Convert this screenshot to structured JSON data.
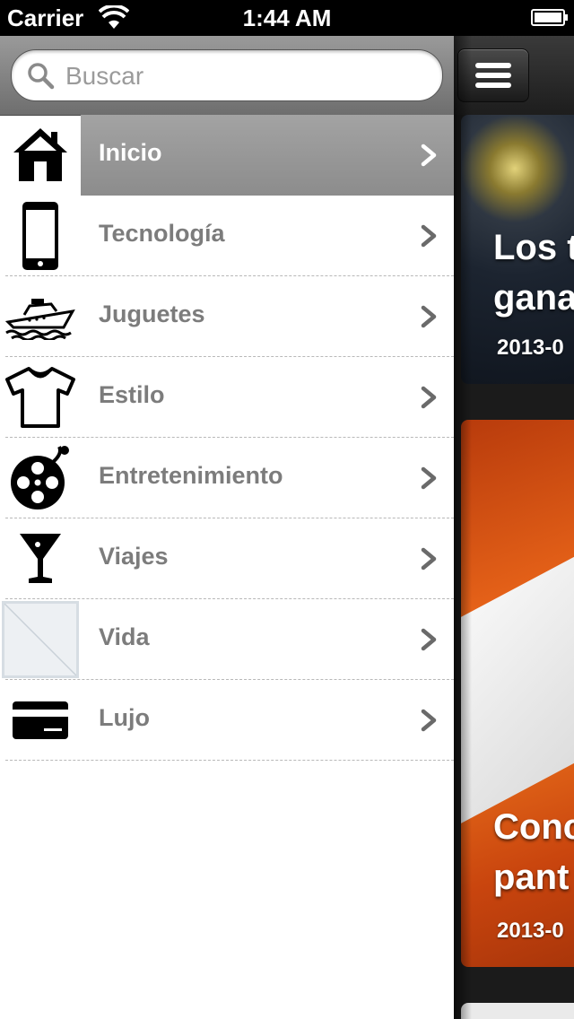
{
  "status_bar": {
    "carrier": "Carrier",
    "time": "1:44 AM"
  },
  "search": {
    "placeholder": "Buscar"
  },
  "menu": {
    "items": [
      {
        "label": "Inicio",
        "icon": "home-icon",
        "active": true
      },
      {
        "label": "Tecnología",
        "icon": "smartphone-icon",
        "active": false
      },
      {
        "label": "Juguetes",
        "icon": "yacht-icon",
        "active": false
      },
      {
        "label": "Estilo",
        "icon": "tshirt-icon",
        "active": false
      },
      {
        "label": "Entretenimiento",
        "icon": "film-reel-icon",
        "active": false
      },
      {
        "label": "Viajes",
        "icon": "cocktail-icon",
        "active": false
      },
      {
        "label": "Vida",
        "icon": "image-placeholder-icon",
        "active": false
      },
      {
        "label": "Lujo",
        "icon": "credit-card-icon",
        "active": false
      }
    ]
  },
  "articles": [
    {
      "title_line1": "Los t",
      "title_line2": "gana",
      "date": "2013-0"
    },
    {
      "title_line1": "Conc",
      "title_line2": "pant",
      "date": "2013-0"
    }
  ],
  "colors": {
    "active_row": "#999999",
    "label_gray": "#7c7c7c",
    "card_orange": "#e86419"
  }
}
